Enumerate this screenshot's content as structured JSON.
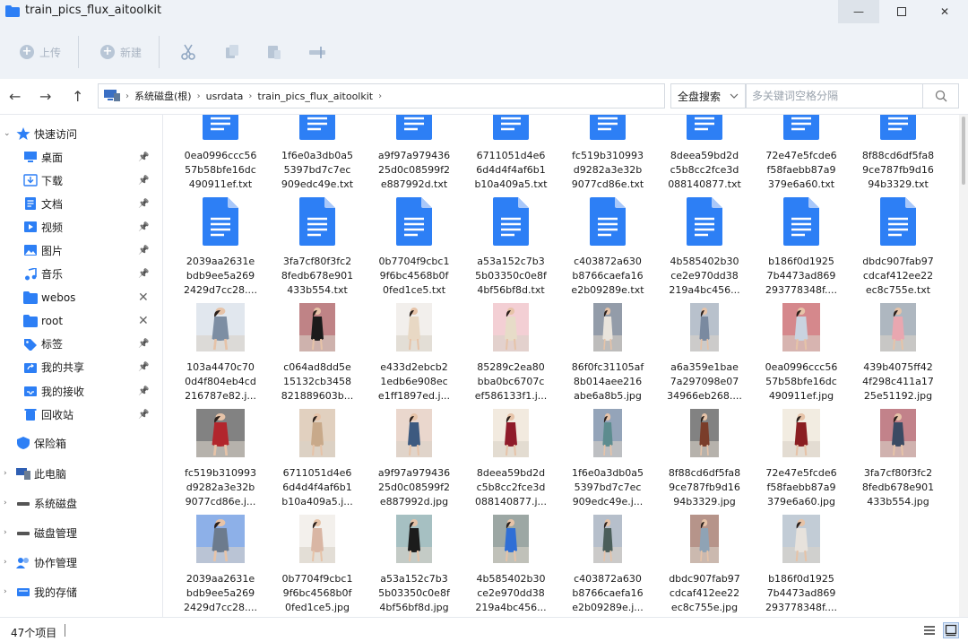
{
  "window": {
    "title": "train_pics_flux_aitoolkit",
    "minimize": "—",
    "close": "✕"
  },
  "toolbar": {
    "upload_label": "上传",
    "new_label": "新建"
  },
  "address": {
    "segments": [
      "系统磁盘(根)",
      "usrdata",
      "train_pics_flux_aitoolkit"
    ],
    "scope_label": "全盘搜索",
    "search_placeholder": "多关键词空格分隔"
  },
  "sidebar": {
    "quick_access": "快速访问",
    "quick_items": [
      {
        "label": "桌面",
        "icon": "desktop-icon",
        "tail": "pin"
      },
      {
        "label": "下载",
        "icon": "download-icon",
        "tail": "pin"
      },
      {
        "label": "文档",
        "icon": "document-icon",
        "tail": "pin"
      },
      {
        "label": "视频",
        "icon": "video-icon",
        "tail": "pin"
      },
      {
        "label": "图片",
        "icon": "image-icon",
        "tail": "pin"
      },
      {
        "label": "音乐",
        "icon": "music-icon",
        "tail": "pin"
      },
      {
        "label": "webos",
        "icon": "folder-icon",
        "tail": "x"
      },
      {
        "label": "root",
        "icon": "folder-icon",
        "tail": "x"
      },
      {
        "label": "标签",
        "icon": "tag-icon",
        "tail": "pin"
      },
      {
        "label": "我的共享",
        "icon": "share-icon",
        "tail": "pin"
      },
      {
        "label": "我的接收",
        "icon": "inbox-icon",
        "tail": "pin"
      },
      {
        "label": "回收站",
        "icon": "recycle-bin-icon",
        "tail": "pin"
      }
    ],
    "safe": "保险箱",
    "sections": [
      "此电脑",
      "系统磁盘",
      "磁盘管理",
      "协作管理",
      "我的存储"
    ]
  },
  "files": [
    [
      "0ea0996ccc56",
      "57b58bfe16dc",
      "490911ef.txt"
    ],
    [
      "1f6e0a3db0a5",
      "5397bd7c7ec",
      "909edc49e.txt"
    ],
    [
      "a9f97a979436",
      "25d0c08599f2",
      "e887992d.txt"
    ],
    [
      "6711051d4e6",
      "6d4d4f4af6b1",
      "b10a409a5.txt"
    ],
    [
      "fc519b310993",
      "d9282a3e32b",
      "9077cd86e.txt"
    ],
    [
      "8deea59bd2d",
      "c5b8cc2fce3d",
      "088140877.txt"
    ],
    [
      "72e47e5fcde6",
      "f58faebb87a9",
      "379e6a60.txt"
    ],
    [
      "8f88cd6df5fa8",
      "9ce787fb9d16",
      "94b3329.txt"
    ],
    [
      "2039aa2631e",
      "bdb9ee5a269",
      "2429d7cc28...."
    ],
    [
      "3fa7cf80f3fc2",
      "8fedb678e901",
      "433b554.txt"
    ],
    [
      "0b7704f9cbc1",
      "9f6bc4568b0f",
      "0fed1ce5.txt"
    ],
    [
      "a53a152c7b3",
      "5b03350c0e8f",
      "4bf56bf8d.txt"
    ],
    [
      "c403872a630",
      "b8766caefa16",
      "e2b09289e.txt"
    ],
    [
      "4b585402b30",
      "ce2e970dd38",
      "219a4bc456..."
    ],
    [
      "b186f0d1925",
      "7b4473ad869",
      "293778348f...."
    ],
    [
      "dbdc907fab97",
      "cdcaf412ee22",
      "ec8c755e.txt"
    ],
    [
      "103a4470c70",
      "0d4f804eb4cd",
      "216787e82.j..."
    ],
    [
      "c064ad8dd5e",
      "15132cb3458",
      "821889603b..."
    ],
    [
      "e433d2ebcb2",
      "1edb6e908ec",
      "e1ff1897ed.j..."
    ],
    [
      "85289c2ea80",
      "bba0bc6707c",
      "ef586133f1.j..."
    ],
    [
      "86f0fc31105af",
      "8b014aee216",
      "abe6a8b5.jpg"
    ],
    [
      "a6a359e1bae",
      "7a297098e07",
      "34966eb268...."
    ],
    [
      "0ea0996ccc56",
      "57b58bfe16dc",
      "490911ef.jpg"
    ],
    [
      "439b4075ff42",
      "4f298c411a17",
      "25e51192.jpg"
    ],
    [
      "fc519b310993",
      "d9282a3e32b",
      "9077cd86e.j..."
    ],
    [
      "6711051d4e6",
      "6d4d4f4af6b1",
      "b10a409a5.j..."
    ],
    [
      "a9f97a979436",
      "25d0c08599f2",
      "e887992d.jpg"
    ],
    [
      "8deea59bd2d",
      "c5b8cc2fce3d",
      "088140877.j..."
    ],
    [
      "1f6e0a3db0a5",
      "5397bd7c7ec",
      "909edc49e.j..."
    ],
    [
      "8f88cd6df5fa8",
      "9ce787fb9d16",
      "94b3329.jpg"
    ],
    [
      "72e47e5fcde6",
      "f58faebb87a9",
      "379e6a60.jpg"
    ],
    [
      "3fa7cf80f3fc2",
      "8fedb678e901",
      "433b554.jpg"
    ],
    [
      "2039aa2631e",
      "bdb9ee5a269",
      "2429d7cc28...."
    ],
    [
      "0b7704f9cbc1",
      "9f6bc4568b0f",
      "0fed1ce5.jpg"
    ],
    [
      "a53a152c7b3",
      "5b03350c0e8f",
      "4bf56bf8d.jpg"
    ],
    [
      "4b585402b30",
      "ce2e970dd38",
      "219a4bc456..."
    ],
    [
      "c403872a630",
      "b8766caefa16",
      "e2b09289e.j..."
    ],
    [
      "dbdc907fab97",
      "cdcaf412ee22",
      "ec8c755e.jpg"
    ],
    [
      "b186f0d1925",
      "7b4473ad869",
      "293778348f...."
    ]
  ],
  "photo_colors": [
    "#c9d3e0",
    "#8a1e22",
    "#e7e2dc",
    "#e9a7b0",
    "#3b4a63",
    "#7d8ea3",
    "#b2262d",
    "#6c7b8d",
    "#1b1b1b",
    "#c8a98a",
    "#d9b6a4",
    "#e8d8c4",
    "#3d5a80",
    "#1c1c1c",
    "#e7dcc8",
    "#8f1b2a",
    "#2f6fd6",
    "#e9e4dc",
    "#5d8c8f",
    "#4b5e5a",
    "#7a8aa0",
    "#7a3d2a",
    "#8fa3b5"
  ],
  "status": {
    "count": "47个项目"
  },
  "accent": "#2d7ff5"
}
